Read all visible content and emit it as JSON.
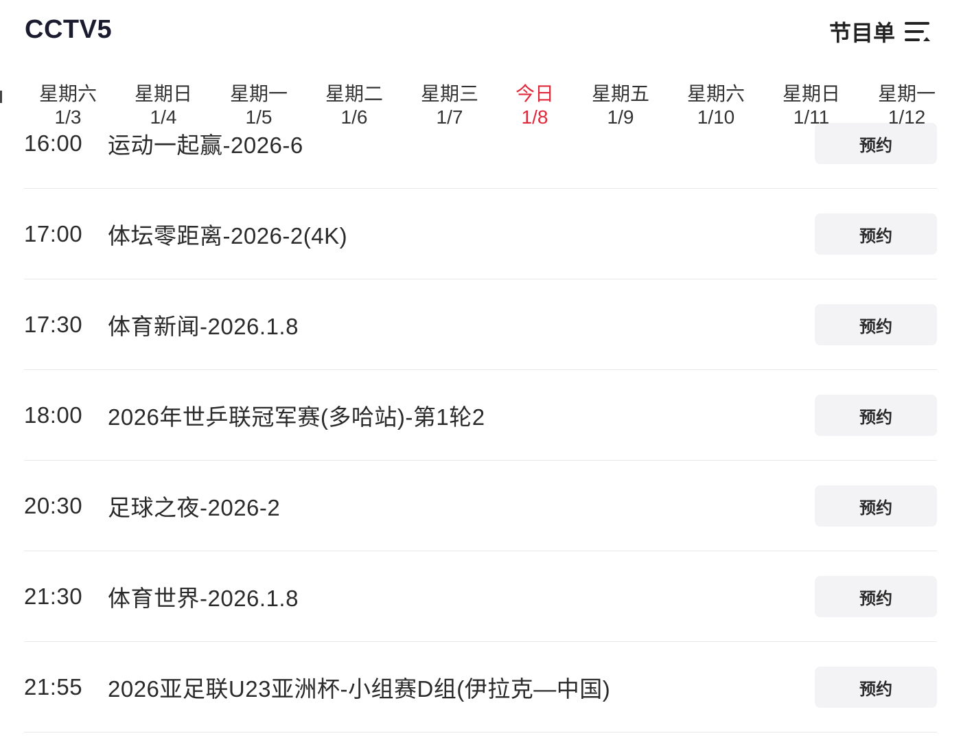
{
  "header": {
    "channel": "CCTV5",
    "schedule_label": "节目单"
  },
  "dates": [
    {
      "weekday": "星期六",
      "date": "1/3"
    },
    {
      "weekday": "星期日",
      "date": "1/4"
    },
    {
      "weekday": "星期一",
      "date": "1/5"
    },
    {
      "weekday": "星期二",
      "date": "1/6"
    },
    {
      "weekday": "星期三",
      "date": "1/7"
    },
    {
      "weekday": "今日",
      "date": "1/8"
    },
    {
      "weekday": "星期五",
      "date": "1/9"
    },
    {
      "weekday": "星期六",
      "date": "1/10"
    },
    {
      "weekday": "星期日",
      "date": "1/11"
    },
    {
      "weekday": "星期一",
      "date": "1/12"
    }
  ],
  "programs": [
    {
      "time": "16:00",
      "title": "运动一起赢-2026-6",
      "action": "预约"
    },
    {
      "time": "17:00",
      "title": "体坛零距离-2026-2(4K)",
      "action": "预约"
    },
    {
      "time": "17:30",
      "title": "体育新闻-2026.1.8",
      "action": "预约"
    },
    {
      "time": "18:00",
      "title": "2026年世乒联冠军赛(多哈站)-第1轮2",
      "action": "预约"
    },
    {
      "time": "20:30",
      "title": "足球之夜-2026-2",
      "action": "预约"
    },
    {
      "time": "21:30",
      "title": "体育世界-2026.1.8",
      "action": "预约"
    },
    {
      "time": "21:55",
      "title": "2026亚足联U23亚洲杯-小组赛D组(伊拉克—中国)",
      "action": "预约"
    }
  ],
  "colors": {
    "accent_today": "#e0283a",
    "button_bg": "#f3f3f5",
    "divider": "#e8e8ea"
  },
  "icons": {
    "schedule": "menu-lines-icon"
  }
}
